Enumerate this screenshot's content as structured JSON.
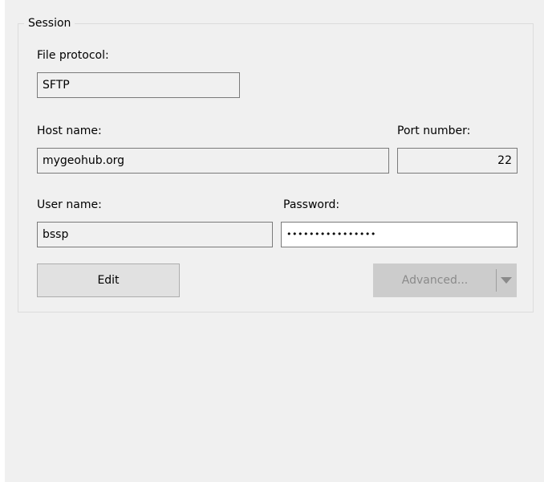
{
  "session": {
    "group_label": "Session",
    "file_protocol": {
      "label": "File protocol:",
      "value": "SFTP"
    },
    "host_name": {
      "label": "Host name:",
      "value": "mygeohub.org"
    },
    "port_number": {
      "label": "Port number:",
      "value": "22"
    },
    "user_name": {
      "label": "User name:",
      "value": "bssp"
    },
    "password": {
      "label": "Password:",
      "value": "••••••••••••••••"
    },
    "buttons": {
      "edit": "Edit",
      "advanced": "Advanced..."
    }
  },
  "icons": {
    "advanced_dropdown": "chevron-down-icon"
  },
  "colors": {
    "panel_background": "#f0f0f0",
    "field_border": "#7a7a7a",
    "button_background": "#e1e1e1",
    "disabled_button_background": "#cccccc"
  }
}
